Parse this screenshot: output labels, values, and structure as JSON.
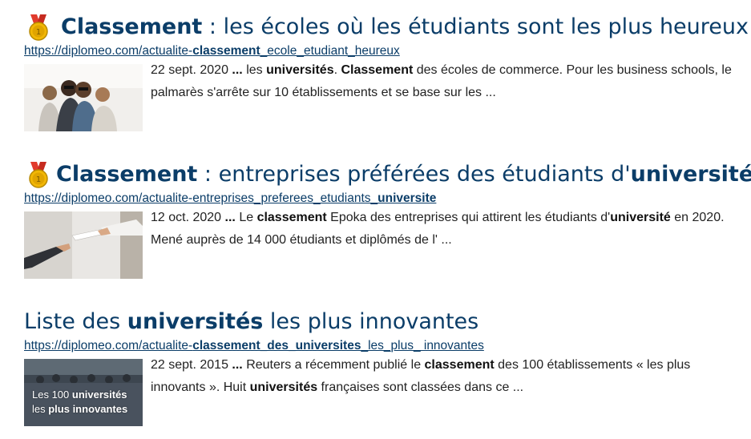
{
  "results": [
    {
      "title_pre": "",
      "title_bold": "Classement",
      "title_post": " : les écoles où les étudiants sont les plus heureux",
      "title_bold2": "",
      "url_pre": "https://diplomeo.com/actualite-",
      "url_bold": "classement",
      "url_post": "_ecole_etudiant_heureux",
      "date": "22 sept. 2020",
      "ellipsis": " ... ",
      "snip_1": "les ",
      "snip_2b": "universités",
      "snip_3": ". ",
      "snip_4b": "Classement",
      "snip_5": " des écoles de commerce. Pour les business schools, le palmarès s'arrête sur 10 établissements et se base sur les ...",
      "medal_icon": "medal-icon",
      "thumb_caption": ""
    },
    {
      "title_bold": "Classement",
      "title_post": " : entreprises préférées des étudiants d'",
      "title_bold2": "université",
      "url_pre": "https://diplomeo.com/actualite-entreprises_preferees_etudiants_",
      "url_bold": "universite",
      "url_post": "",
      "date": "12 oct. 2020",
      "ellipsis": " ... ",
      "snip_1": "Le ",
      "snip_2b": "classement",
      "snip_3": " Epoka des entreprises qui attirent les étudiants d'",
      "snip_4b": "université",
      "snip_5": " en 2020. Mené auprès de 14 000 étudiants et diplômés de l' ...",
      "medal_icon": "medal-icon"
    },
    {
      "title_pre": "Liste des ",
      "title_bold": "universités",
      "title_post": " les plus innovantes",
      "url_pre": "https://diplomeo.com/actualite-",
      "url_bold": "classement_des_universites",
      "url_post": "_les_plus_ innovantes",
      "date": "22 sept. 2015",
      "ellipsis": " ... ",
      "snip_1": "Reuters a récemment publié le ",
      "snip_2b": "classement",
      "snip_3": " des 100 établissements « les plus innovants ». Huit ",
      "snip_4b": "universités",
      "snip_5": " françaises sont classées dans ce ...",
      "thumb_line1_pre": "Les 100 ",
      "thumb_line1_b": "universités",
      "thumb_line2_pre": "les ",
      "thumb_line2_b": "plus innovantes"
    }
  ],
  "colors": {
    "title": "#0b3d68",
    "text": "#222222",
    "medal_gold": "#f2b705",
    "medal_red": "#e13b2d"
  }
}
